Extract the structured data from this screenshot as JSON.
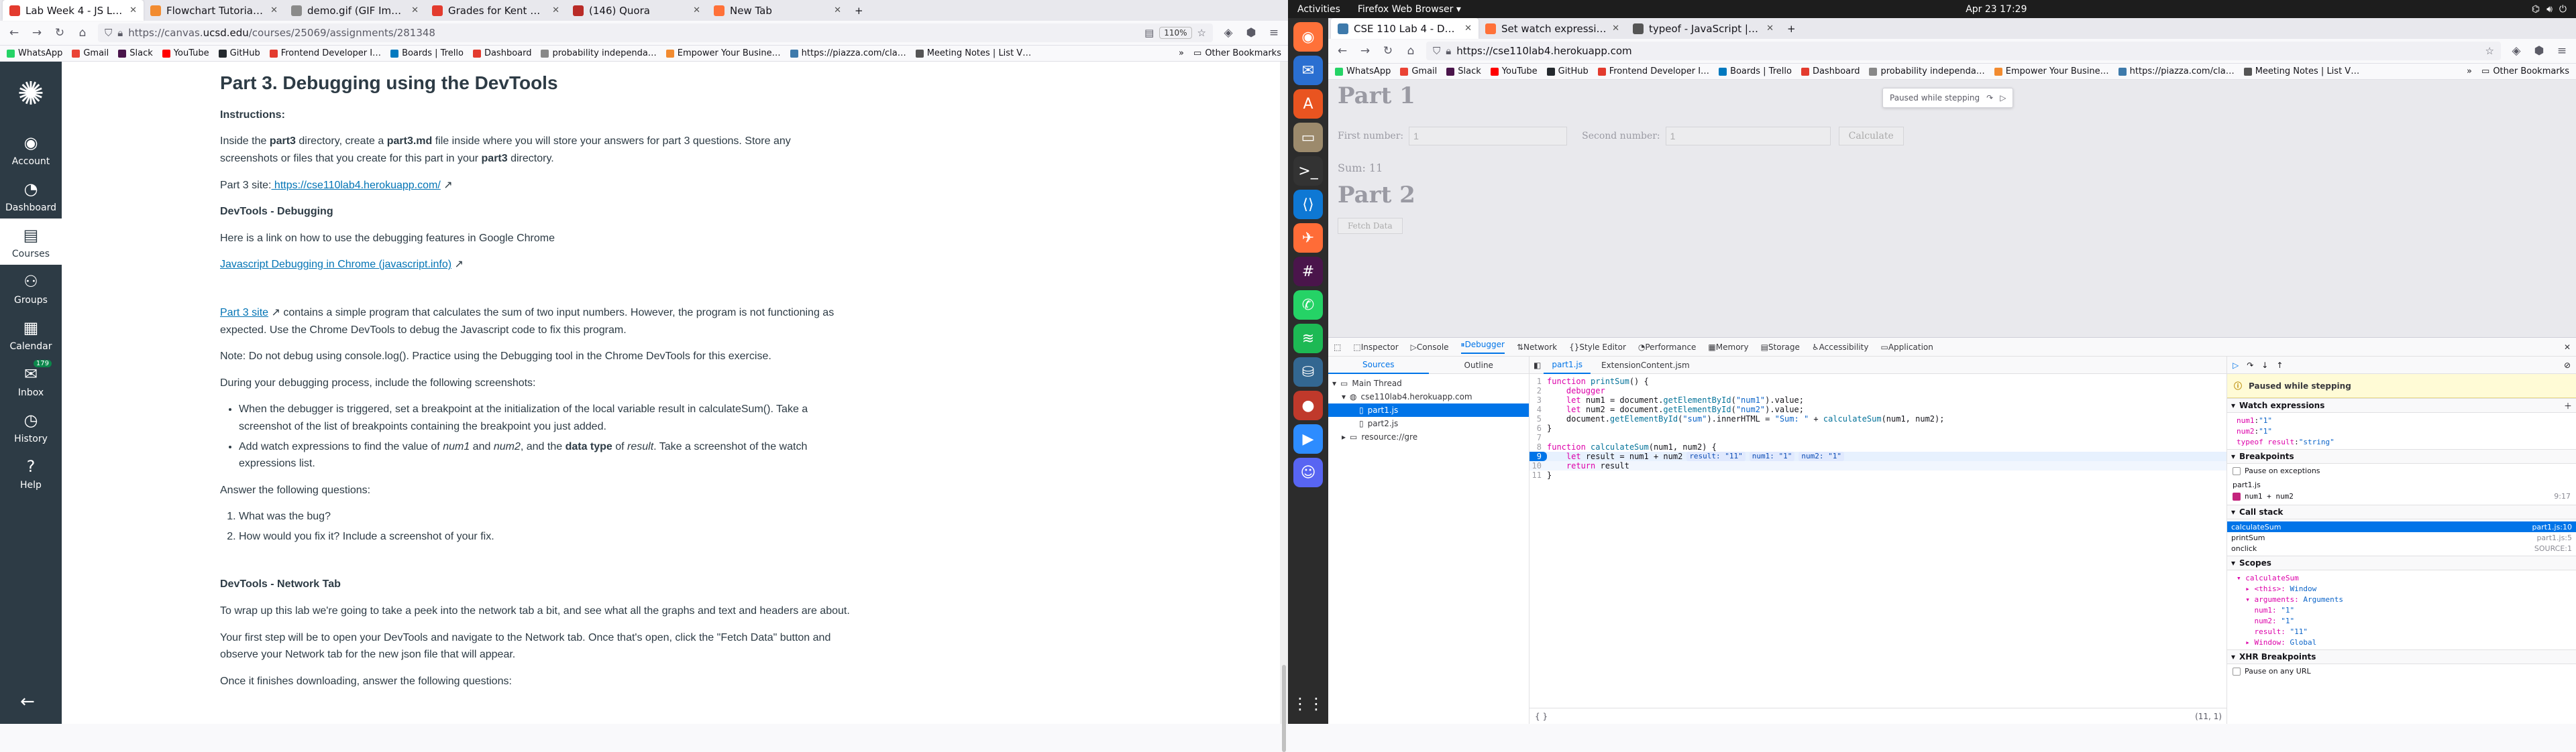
{
  "left_window": {
    "tabs": [
      {
        "title": "Lab Week 4 - JS Langua…",
        "active": true,
        "color": "#e33b2e"
      },
      {
        "title": "Flowchart Tutorial (with…",
        "active": false,
        "color": "#f28b30"
      },
      {
        "title": "demo.gif (GIF Image, 1895 ×…",
        "active": false,
        "color": "#8a8a8a"
      },
      {
        "title": "Grades for Kent Utomo:…",
        "active": false,
        "color": "#e33b2e"
      },
      {
        "title": "(146) Quora",
        "active": false,
        "color": "#b92b27"
      },
      {
        "title": "New Tab",
        "active": false,
        "color": "#ff7139"
      }
    ],
    "url_prefix": "https://canvas.",
    "url_domain": "ucsd.edu",
    "url_rest": "/courses/25069/assignments/281348",
    "zoom": "110%",
    "bookmarks": [
      {
        "label": "WhatsApp",
        "color": "#25d366"
      },
      {
        "label": "Gmail",
        "color": "#ea4335"
      },
      {
        "label": "Slack",
        "color": "#4a154b"
      },
      {
        "label": "YouTube",
        "color": "#ff0000"
      },
      {
        "label": "GitHub",
        "color": "#24292e"
      },
      {
        "label": "Frontend Developer I…",
        "color": "#e33b2e"
      },
      {
        "label": "Boards | Trello",
        "color": "#0079bf"
      },
      {
        "label": "Dashboard",
        "color": "#e33b2e"
      },
      {
        "label": "probability independa…",
        "color": "#888888"
      },
      {
        "label": "Empower Your Busine…",
        "color": "#f28b30"
      },
      {
        "label": "https://piazza.com/cla…",
        "color": "#3e7aab"
      },
      {
        "label": "Meeting Notes | List V…",
        "color": "#555555"
      }
    ],
    "other_bookmarks": "Other Bookmarks",
    "canvas_nav": [
      {
        "label": "Account",
        "icon": "user-icon"
      },
      {
        "label": "Dashboard",
        "icon": "dashboard-icon"
      },
      {
        "label": "Courses",
        "icon": "book-icon",
        "active": true
      },
      {
        "label": "Groups",
        "icon": "groups-icon"
      },
      {
        "label": "Calendar",
        "icon": "calendar-icon"
      },
      {
        "label": "Inbox",
        "icon": "inbox-icon",
        "badge": "179"
      },
      {
        "label": "History",
        "icon": "clock-icon"
      },
      {
        "label": "Help",
        "icon": "help-icon"
      }
    ],
    "collapse_icon": "←",
    "content": {
      "title": "Part 3. Debugging using the DevTools",
      "instructions_label": "Instructions:",
      "p1_a": "Inside the ",
      "p1_b": "part3",
      "p1_c": " directory, create a ",
      "p1_d": "part3.md",
      "p1_e": " file inside where you will store your answers for part 3 questions. Store any screenshots or files that you create for this part in your ",
      "p1_f": "part3",
      "p1_g": " directory.",
      "site_label": "Part 3 site:",
      "site_link": " https://cse110lab4.herokuapp.com/",
      "h_debug": "DevTools - Debugging",
      "p_link_intro": "Here is a link on how to use the debugging features in Google Chrome",
      "js_debug_link": "Javascript Debugging in Chrome (javascript.info)",
      "part3_site_link": "Part 3 site",
      "p_part3_rest": " contains a simple program that calculates the sum of two input numbers. However, the program is not functioning as expected. Use the Chrome DevTools to debug the Javascript code to fix this program.",
      "p_note": "Note: Do not debug using console.log(). Practice using the Debugging tool in the Chrome DevTools for this exercise.",
      "p_during": "During your debugging process, include the following screenshots:",
      "bullet1": "When the debugger is triggered, set a breakpoint at the initialization of the local variable result in calculateSum(). Take a screenshot of the list of breakpoints containing the breakpoint you just added.",
      "bullet2_a": "Add watch expressions to find the value of ",
      "bullet2_b": "num1",
      "bullet2_c": " and ",
      "bullet2_d": "num2",
      "bullet2_e": ", and the ",
      "bullet2_f": "data type",
      "bullet2_g": " of ",
      "bullet2_h": "result",
      "bullet2_i": ". Take a screenshot of the watch expressions list.",
      "p_answer": "Answer the following questions:",
      "q1": "What was the bug?",
      "q2": "How would you fix it? Include a screenshot of your fix.",
      "h_network": "DevTools - Network Tab",
      "p_net1": "To wrap up this lab we're going to take a peek into the network tab a bit, and see what all the graphs and text and headers are about.",
      "p_net2": "Your first step will be to open your DevTools and navigate to the Network tab. Once that's open, click the \"Fetch Data\" button and observe your Network tab for the new json file that will appear.",
      "p_net3": "Once it finishes downloading, answer the following questions:"
    }
  },
  "topbar": {
    "activities": "Activities",
    "app": "Firefox Web Browser ▾",
    "clock": "Apr 23  17:29"
  },
  "dock_items": [
    {
      "icon": "firefox-icon",
      "color": "#ff7139"
    },
    {
      "icon": "thunderbird-icon",
      "color": "#2a6fd1"
    },
    {
      "icon": "software-icon",
      "color": "#e95420"
    },
    {
      "icon": "files-icon",
      "color": "#9c8a6c"
    },
    {
      "icon": "terminal-icon",
      "color": "#333333"
    },
    {
      "icon": "vscode-icon",
      "color": "#0e78d4"
    },
    {
      "icon": "postman-icon",
      "color": "#ff6c37"
    },
    {
      "icon": "slack-icon",
      "color": "#4a154b"
    },
    {
      "icon": "whatsapp-icon",
      "color": "#25d366"
    },
    {
      "icon": "spotify-icon",
      "color": "#1db954"
    },
    {
      "icon": "postgres-icon",
      "color": "#336791"
    },
    {
      "icon": "recorder-icon",
      "color": "#c0392b"
    },
    {
      "icon": "zoom-icon",
      "color": "#2d8cff"
    },
    {
      "icon": "discord-icon",
      "color": "#5865f2"
    }
  ],
  "right_window": {
    "tabs": [
      {
        "title": "CSE 110 Lab 4 - Debugging",
        "active": true,
        "color": "#3e7aab"
      },
      {
        "title": "Set watch expressions —…",
        "active": false,
        "color": "#ff7139"
      },
      {
        "title": "typeof - JavaScript | MDN…",
        "active": false,
        "color": "#555555"
      }
    ],
    "url": "https://cse110lab4.herokuapp.com",
    "bookmarks": [
      {
        "label": "WhatsApp",
        "color": "#25d366"
      },
      {
        "label": "Gmail",
        "color": "#ea4335"
      },
      {
        "label": "Slack",
        "color": "#4a154b"
      },
      {
        "label": "YouTube",
        "color": "#ff0000"
      },
      {
        "label": "GitHub",
        "color": "#24292e"
      },
      {
        "label": "Frontend Developer I…",
        "color": "#e33b2e"
      },
      {
        "label": "Boards | Trello",
        "color": "#0079bf"
      },
      {
        "label": "Dashboard",
        "color": "#e33b2e"
      },
      {
        "label": "probability independa…",
        "color": "#888888"
      },
      {
        "label": "Empower Your Busine…",
        "color": "#f28b30"
      },
      {
        "label": "https://piazza.com/cla…",
        "color": "#3e7aab"
      },
      {
        "label": "Meeting Notes | List V…",
        "color": "#555555"
      }
    ],
    "other_bookmarks": "Other Bookmarks",
    "page": {
      "part1": "Part 1",
      "first_number_label": "First number:",
      "first_number_value": "1",
      "second_number_label": "Second number:",
      "second_number_value": "1",
      "calculate": "Calculate",
      "sum": "Sum: 11",
      "part2": "Part 2",
      "fetch": "Fetch Data",
      "paused_chip": "Paused while stepping"
    },
    "devtools": {
      "tabs": [
        "Inspector",
        "Console",
        "Debugger",
        "Network",
        "Style Editor",
        "Performance",
        "Memory",
        "Storage",
        "Accessibility",
        "Application"
      ],
      "active_tab": "Debugger",
      "sources_tab": "Sources",
      "outline_tab": "Outline",
      "tree": {
        "main_thread": "Main Thread",
        "host": "cse110lab4.herokuapp.com",
        "file1": "part1.js",
        "file2": "part2.js",
        "resource": "resource://gre"
      },
      "file_tabs": [
        "part1.js",
        "ExtensionContent.jsm"
      ],
      "code": [
        {
          "n": "1",
          "t": "function printSum() {"
        },
        {
          "n": "2",
          "t": "    debugger"
        },
        {
          "n": "3",
          "t": "    let num1 = document.getElementById(\"num1\").value;"
        },
        {
          "n": "4",
          "t": "    let num2 = document.getElementById(\"num2\").value;"
        },
        {
          "n": "5",
          "t": "    document.getElementById(\"sum\").innerHTML = \"Sum: \" + calculateSum(num1, num2);"
        },
        {
          "n": "6",
          "t": "}"
        },
        {
          "n": "7",
          "t": ""
        },
        {
          "n": "8",
          "t": "function calculateSum(num1, num2) {"
        },
        {
          "n": "9",
          "t": "    let result = num1 + num2"
        },
        {
          "n": "10",
          "t": "    return result"
        },
        {
          "n": "11",
          "t": "}"
        }
      ],
      "inline_values": [
        "result: \"11\"",
        "num1: \"1\"",
        "num2: \"1\""
      ],
      "status_left": "{ }",
      "status_right": "(11, 1)",
      "paused_banner": "Paused while stepping",
      "watch_header": "Watch expressions",
      "watch": [
        {
          "k": "num1",
          "v": "\"1\""
        },
        {
          "k": "num2",
          "v": "\"1\""
        },
        {
          "k": "typeof result",
          "v": "\"string\""
        }
      ],
      "breakpoints_header": "Breakpoints",
      "pause_exceptions": "Pause on exceptions",
      "bp_file": "part1.js",
      "bp_line_text": "num1 + num2",
      "bp_line_loc": "9:17",
      "callstack_header": "Call stack",
      "frames": [
        {
          "name": "calculateSum",
          "src": "part1.js:10"
        },
        {
          "name": "printSum",
          "src": "part1.js:5"
        },
        {
          "name": "onclick",
          "src": "SOURCE:1"
        }
      ],
      "scopes_header": "Scopes",
      "scopes": [
        {
          "k": "▾ calculateSum",
          "v": ""
        },
        {
          "k": "  ▸ <this>: ",
          "v": "Window"
        },
        {
          "k": "  ▾ arguments: ",
          "v": "Arguments"
        },
        {
          "k": "    num1: ",
          "v": "\"1\""
        },
        {
          "k": "    num2: ",
          "v": "\"1\""
        },
        {
          "k": "    result: ",
          "v": "\"11\""
        },
        {
          "k": "  ▸ Window: ",
          "v": "Global"
        }
      ],
      "xhr_header": "XHR Breakpoints",
      "pause_any_url": "Pause on any URL"
    }
  }
}
